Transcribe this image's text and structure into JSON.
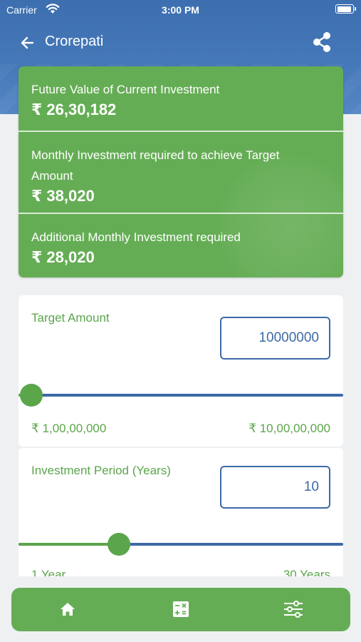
{
  "status_bar": {
    "carrier": "Carrier",
    "time": "3:00 PM"
  },
  "navbar": {
    "title": "Crorepati"
  },
  "results": [
    {
      "label": "Future Value of Current Investment",
      "value": "₹ 26,30,182"
    },
    {
      "label": "Monthly Investment required to achieve Target Amount",
      "value": "₹ 38,020"
    },
    {
      "label": "Additional Monthly Investment required",
      "value": "₹ 28,020"
    }
  ],
  "target_amount": {
    "label": "Target Amount",
    "value": "10000000",
    "slider_fraction": 0.04,
    "min_label": "₹ 1,00,00,000",
    "max_label": "₹ 10,00,00,000"
  },
  "investment_period": {
    "label": "Investment Period (Years)",
    "value": "10",
    "slider_fraction": 0.31,
    "min_label": "1 Year",
    "max_label": "30 Years"
  },
  "colors": {
    "header_blue": "#4679b9",
    "accent_green": "#65ad55",
    "input_blue": "#3d6aa6"
  },
  "bottom_nav": {
    "icons": [
      "home-icon",
      "calculator-icon",
      "sliders-icon"
    ]
  }
}
